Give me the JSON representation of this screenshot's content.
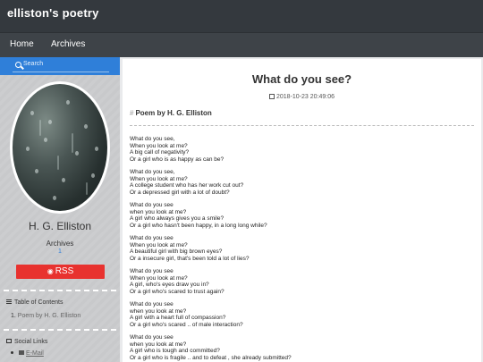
{
  "site": {
    "title": "elliston's poetry"
  },
  "nav": {
    "items": [
      {
        "label": "Home"
      },
      {
        "label": "Archives"
      }
    ]
  },
  "sidebar": {
    "search_placeholder": "Search",
    "author_name": "H. G. Elliston",
    "archives_label": "Archives",
    "archives_count": "1",
    "rss_label": "RSS",
    "toc_title": "Table of Contents",
    "toc_items": [
      {
        "number": "1.",
        "label": "Poem by H. G. Elliston"
      }
    ],
    "social_title": "Social Links",
    "social_items": [
      {
        "label": "E-Mail"
      }
    ]
  },
  "post": {
    "title": "What do you see?",
    "date": "2018-10-23 20:49:06",
    "heading_marker": "#",
    "heading": "Poem by H. G. Elliston",
    "stanzas": [
      [
        "What do you see,",
        "When you look at me?",
        "A big call of negativity?",
        "Or a girl who is as happy as can be?"
      ],
      [
        "What do you see,",
        "When you look at me?",
        "A college student who has her work cut out?",
        "Or a depressed girl with a lot of doubt?"
      ],
      [
        "What do you see",
        "when you look at me?",
        "A girl who always gives you a smile?",
        "Or a girl who hasn't been happy, in a long long while?"
      ],
      [
        "What do you see",
        "When you look at me?",
        "A beautiful girl with big brown eyes?",
        "Or a insecure girl, that's been told a lot of lies?"
      ],
      [
        "What do you see",
        "When you look at me?",
        "A girl, who's eyes draw you in?",
        "Or a girl who's scared to trust again?"
      ],
      [
        "What do you see",
        "when you look at me?",
        "A girl with a heart full of compassion?",
        "Or a girl who's scared .. of male interaction?"
      ],
      [
        "What do you see",
        "when you look at me?",
        "A girl who is tough and committed?",
        "Or a girl who is fragile .. and to defeat , she already submitted?"
      ]
    ]
  },
  "colors": {
    "topbar": "#34393e",
    "navbar": "#3e4348",
    "search": "#2f7fd9",
    "rss": "#e8322f"
  },
  "icons": [
    "search-icon",
    "rss-icon",
    "list-icon",
    "calendar-icon",
    "address-card-icon",
    "envelope-icon"
  ]
}
